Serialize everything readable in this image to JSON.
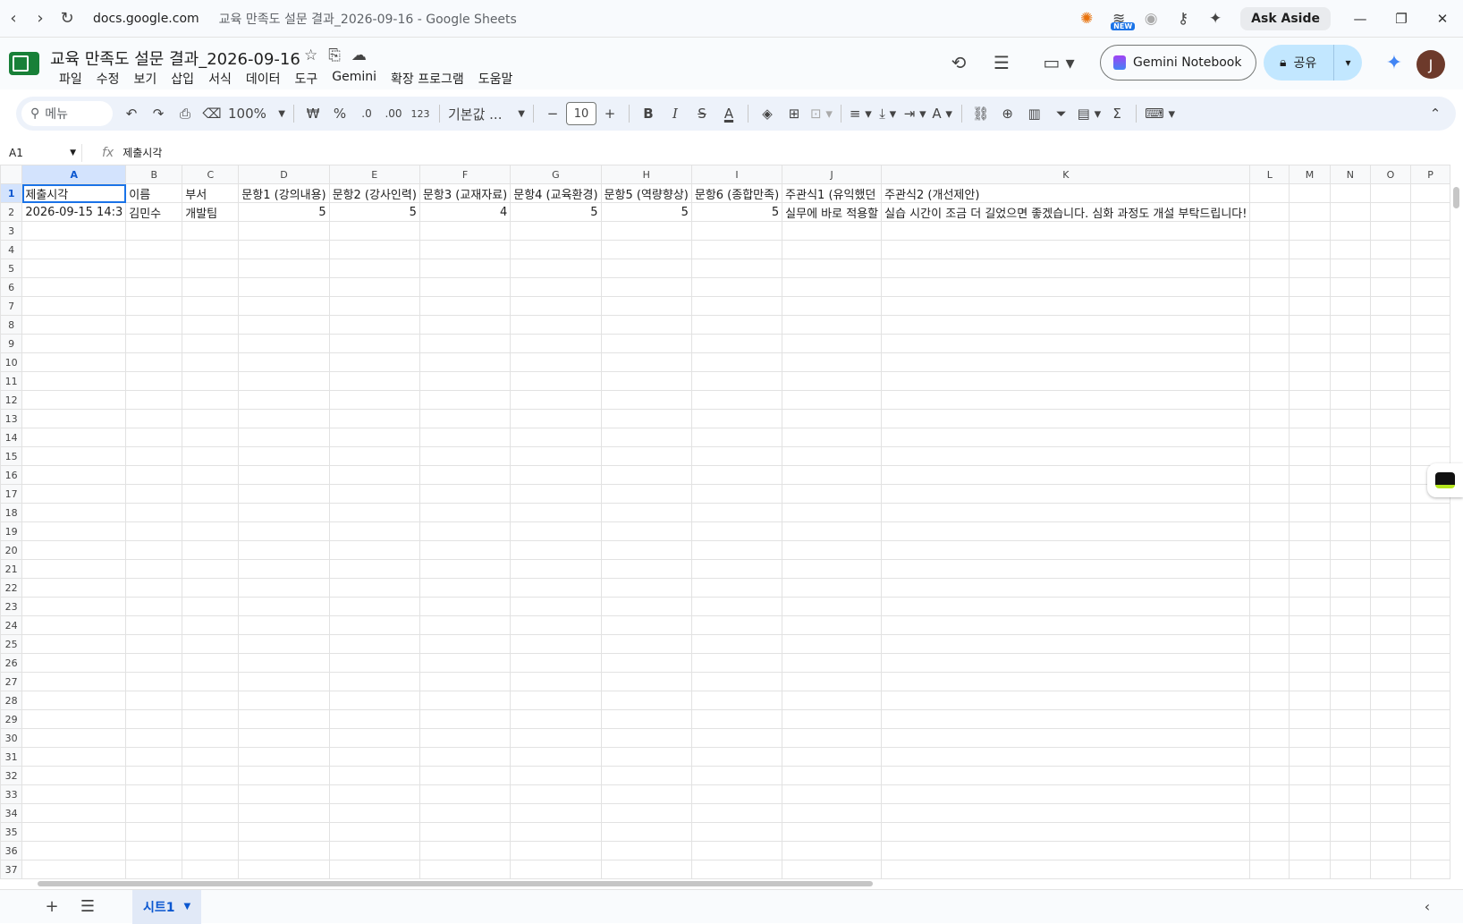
{
  "browser": {
    "url": "docs.google.com",
    "page_title": "교육 만족도 설문 결과_2026-09-16 - Google Sheets",
    "ask_aside": "Ask Aside",
    "new_badge": "NEW"
  },
  "doc": {
    "title": "교육 만족도 설문 결과_2026-09-16",
    "menus": [
      "파일",
      "수정",
      "보기",
      "삽입",
      "서식",
      "데이터",
      "도구",
      "Gemini",
      "확장 프로그램",
      "도움말"
    ],
    "gemini_notebook": "Gemini Notebook",
    "share": "공유",
    "avatar": "J"
  },
  "toolbar": {
    "search": "메뉴",
    "zoom": "100%",
    "currency": "₩",
    "percent": "%",
    "dec_minus": ".0",
    "dec_plus": ".00",
    "number_format": "123",
    "font": "기본값 ...",
    "font_size": "10"
  },
  "formula": {
    "cell_ref": "A1",
    "fx": "fx",
    "value": "제출시각"
  },
  "grid": {
    "columns": [
      "A",
      "B",
      "C",
      "D",
      "E",
      "F",
      "G",
      "H",
      "I",
      "J",
      "K",
      "L",
      "M",
      "N",
      "O",
      "P"
    ],
    "row_count": 37,
    "rows": [
      [
        "제출시각",
        "이름",
        "부서",
        "문항1 (강의내용)",
        "문항2 (강사인력)",
        "문항3 (교재자료)",
        "문항4 (교육환경)",
        "문항5 (역량향상)",
        "문항6 (종합만족)",
        "주관식1 (유익했던",
        "주관식2 (개선제안)",
        "",
        "",
        "",
        "",
        ""
      ],
      [
        "2026-09-15 14:3",
        "김민수",
        "개발팀",
        "5",
        "5",
        "4",
        "5",
        "5",
        "5",
        "실무에 바로 적용할",
        "실습 시간이 조금 더 길었으면 좋겠습니다. 심화 과정도 개설 부탁드립니다!",
        "",
        "",
        "",
        "",
        ""
      ]
    ]
  },
  "sheets": {
    "tabs": [
      "시트1"
    ]
  }
}
